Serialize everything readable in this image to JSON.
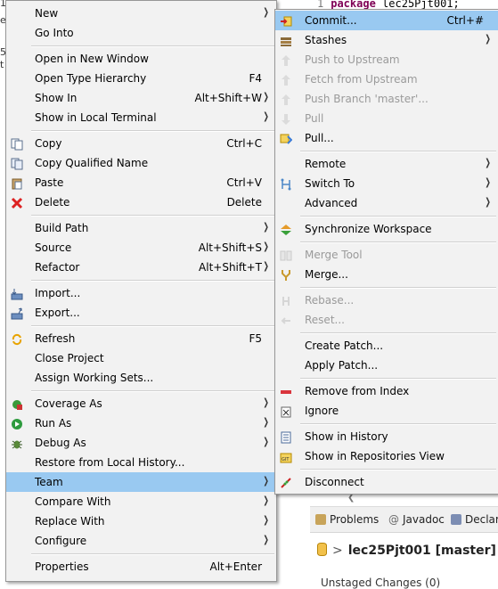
{
  "background": {
    "edge_chars": [
      "1",
      "e",
      "5",
      "t"
    ],
    "editor_line_number": "1",
    "editor_keyword": "package",
    "editor_text": "lec25Pjt001;",
    "bottom_tabs": [
      {
        "label": "Problems",
        "icon": "problems-icon"
      },
      {
        "label": "Javadoc",
        "icon": "javadoc-icon"
      },
      {
        "label": "Declar",
        "icon": "declaration-icon"
      }
    ],
    "staging_title": "lec25Pjt001 [master]",
    "unstaged_changes": "Unstaged Changes (0)"
  },
  "main_menu": {
    "items": [
      {
        "label": "New",
        "submenu": true
      },
      {
        "label": "Go Into"
      },
      {
        "sep": true
      },
      {
        "label": "Open in New Window"
      },
      {
        "label": "Open Type Hierarchy",
        "shortcut": "F4"
      },
      {
        "label": "Show In",
        "shortcut": "Alt+Shift+W",
        "submenu": true
      },
      {
        "label": "Show in Local Terminal",
        "submenu": true
      },
      {
        "sep": true
      },
      {
        "label": "Copy",
        "shortcut": "Ctrl+C",
        "icon": "copy-icon"
      },
      {
        "label": "Copy Qualified Name",
        "icon": "copy-qualified-icon"
      },
      {
        "label": "Paste",
        "shortcut": "Ctrl+V",
        "icon": "paste-icon"
      },
      {
        "label": "Delete",
        "shortcut": "Delete",
        "icon": "delete-icon"
      },
      {
        "sep": true
      },
      {
        "label": "Build Path",
        "submenu": true
      },
      {
        "label": "Source",
        "shortcut": "Alt+Shift+S",
        "submenu": true
      },
      {
        "label": "Refactor",
        "shortcut": "Alt+Shift+T",
        "submenu": true
      },
      {
        "sep": true
      },
      {
        "label": "Import...",
        "icon": "import-icon"
      },
      {
        "label": "Export...",
        "icon": "export-icon"
      },
      {
        "sep": true
      },
      {
        "label": "Refresh",
        "shortcut": "F5",
        "icon": "refresh-icon"
      },
      {
        "label": "Close Project"
      },
      {
        "label": "Assign Working Sets..."
      },
      {
        "sep": true
      },
      {
        "label": "Coverage As",
        "submenu": true,
        "icon": "coverage-icon"
      },
      {
        "label": "Run As",
        "submenu": true,
        "icon": "run-icon"
      },
      {
        "label": "Debug As",
        "submenu": true,
        "icon": "debug-icon"
      },
      {
        "label": "Restore from Local History..."
      },
      {
        "label": "Team",
        "submenu": true,
        "selected": true
      },
      {
        "label": "Compare With",
        "submenu": true
      },
      {
        "label": "Replace With",
        "submenu": true
      },
      {
        "label": "Configure",
        "submenu": true
      },
      {
        "sep": true
      },
      {
        "label": "Properties",
        "shortcut": "Alt+Enter"
      }
    ]
  },
  "team_menu": {
    "items": [
      {
        "label": "Commit...",
        "shortcut": "Ctrl+#",
        "icon": "commit-icon",
        "selected": true
      },
      {
        "label": "Stashes",
        "submenu": true,
        "icon": "stash-icon"
      },
      {
        "label": "Push to Upstream",
        "disabled": true,
        "icon": "push-icon"
      },
      {
        "label": "Fetch from Upstream",
        "disabled": true,
        "icon": "fetch-icon"
      },
      {
        "label": "Push Branch 'master'...",
        "disabled": true,
        "icon": "push-branch-icon"
      },
      {
        "label": "Pull",
        "disabled": true,
        "icon": "pull-icon"
      },
      {
        "label": "Pull...",
        "icon": "pull-dialog-icon"
      },
      {
        "sep": true
      },
      {
        "label": "Remote",
        "submenu": true
      },
      {
        "label": "Switch To",
        "submenu": true,
        "icon": "branch-icon"
      },
      {
        "label": "Advanced",
        "submenu": true
      },
      {
        "sep": true
      },
      {
        "label": "Synchronize Workspace",
        "icon": "synchronize-icon"
      },
      {
        "sep": true
      },
      {
        "label": "Merge Tool",
        "disabled": true,
        "icon": "merge-tool-icon"
      },
      {
        "label": "Merge...",
        "icon": "merge-icon"
      },
      {
        "sep": true
      },
      {
        "label": "Rebase...",
        "disabled": true,
        "icon": "rebase-icon"
      },
      {
        "label": "Reset...",
        "disabled": true,
        "icon": "reset-icon"
      },
      {
        "sep": true
      },
      {
        "label": "Create Patch..."
      },
      {
        "label": "Apply Patch..."
      },
      {
        "sep": true
      },
      {
        "label": "Remove from Index",
        "icon": "remove-index-icon"
      },
      {
        "label": "Ignore",
        "icon": "ignore-icon"
      },
      {
        "sep": true
      },
      {
        "label": "Show in History",
        "icon": "history-icon"
      },
      {
        "label": "Show in Repositories View",
        "icon": "repositories-icon"
      },
      {
        "sep": true
      },
      {
        "label": "Disconnect",
        "icon": "disconnect-icon"
      }
    ]
  },
  "colors": {
    "selection": "#99c9f1",
    "menu_background": "#f2f2f2",
    "disabled_text": "#9a9a9a"
  }
}
